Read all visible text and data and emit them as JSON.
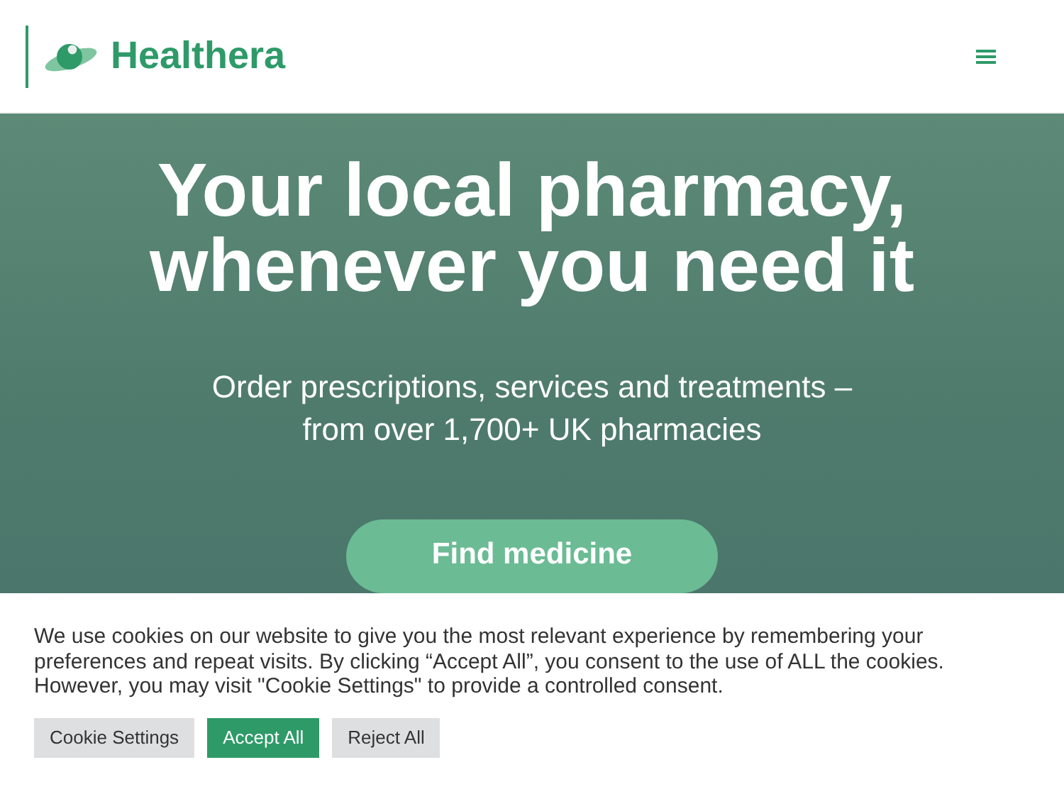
{
  "header": {
    "logo_text": "Healthera"
  },
  "hero": {
    "title_lines": [
      "Your local pharmacy,",
      "whenever you need it"
    ],
    "subtitle_lines": [
      "Order prescriptions, services and treatments –",
      "from over 1,700+ UK pharmacies"
    ],
    "button": "Find medicine"
  },
  "cookie_banner": {
    "text": "We use cookies on our website to give you the most relevant experience by remembering your preferences and repeat visits. By clicking “Accept All”, you consent to the use of ALL the cookies. However, you may visit \"Cookie Settings\" to provide a controlled consent.",
    "buttons": [
      {
        "label": "Cookie Settings",
        "kind": "secondary"
      },
      {
        "label": "Accept All",
        "kind": "primary"
      },
      {
        "label": "Reject All",
        "kind": "secondary"
      }
    ]
  }
}
